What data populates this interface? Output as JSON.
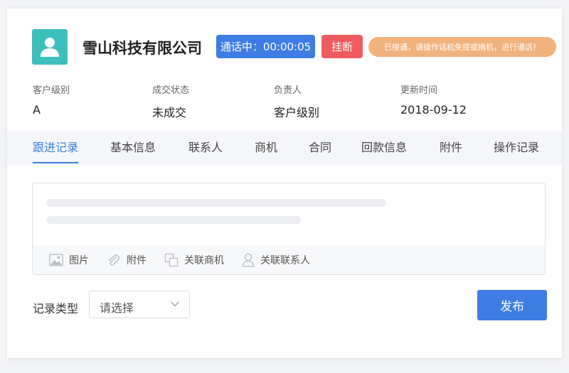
{
  "header": {
    "company_name": "雪山科技有限公司",
    "call_status": "通话中：00:00:05",
    "hangup_label": "挂断",
    "notice": "已接通，请操作话机免提或摘机，进行通话！"
  },
  "info": [
    {
      "label": "客户级别",
      "value": "A"
    },
    {
      "label": "成交状态",
      "value": "未成交"
    },
    {
      "label": "负责人",
      "value": "客户级别"
    },
    {
      "label": "更新时间",
      "value": "2018-09-12"
    }
  ],
  "tabs": [
    {
      "label": "跟进记录",
      "active": true
    },
    {
      "label": "基本信息"
    },
    {
      "label": "联系人"
    },
    {
      "label": "商机"
    },
    {
      "label": "合同"
    },
    {
      "label": "回款信息"
    },
    {
      "label": "附件"
    },
    {
      "label": "操作记录"
    }
  ],
  "editor": {
    "toolbar": [
      {
        "label": "图片",
        "icon": "image-icon"
      },
      {
        "label": "附件",
        "icon": "paperclip-icon"
      },
      {
        "label": "关联商机",
        "icon": "copy-link-icon"
      },
      {
        "label": "关联联系人",
        "icon": "person-icon"
      }
    ]
  },
  "form": {
    "record_type_label": "记录类型",
    "record_type_placeholder": "请选择",
    "publish_label": "发布"
  },
  "colors": {
    "primary": "#3d7de4",
    "danger": "#ef5b5e",
    "notice": "#f2b27c",
    "avatar": "#3cbfbd"
  }
}
